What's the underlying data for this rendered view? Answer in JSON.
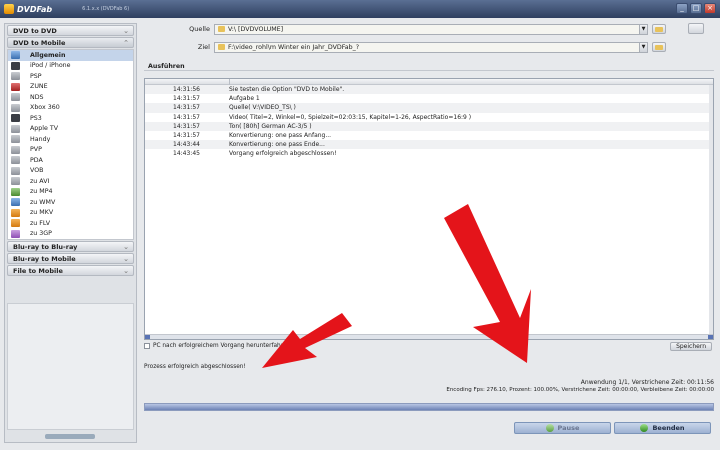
{
  "app": {
    "title": "DVDFab",
    "version": "6.1.x.x (DVDFab 6)"
  },
  "sidebar": {
    "categories_top": [
      "DVD to DVD",
      "DVD to Mobile"
    ],
    "items": [
      {
        "label": "Allgemein",
        "icon": "general-icon"
      },
      {
        "label": "iPod / iPhone",
        "icon": "ipod-icon"
      },
      {
        "label": "PSP",
        "icon": "psp-icon"
      },
      {
        "label": "ZUNE",
        "icon": "zune-icon"
      },
      {
        "label": "NDS",
        "icon": "nds-icon"
      },
      {
        "label": "Xbox 360",
        "icon": "xbox-icon"
      },
      {
        "label": "PS3",
        "icon": "ps3-icon"
      },
      {
        "label": "Apple TV",
        "icon": "appletv-icon"
      },
      {
        "label": "Handy",
        "icon": "phone-icon"
      },
      {
        "label": "PVP",
        "icon": "pvp-icon"
      },
      {
        "label": "PDA",
        "icon": "pda-icon"
      },
      {
        "label": "VOB",
        "icon": "vob-icon"
      },
      {
        "label": "zu AVI",
        "icon": "avi-icon"
      },
      {
        "label": "zu MP4",
        "icon": "mp4-icon"
      },
      {
        "label": "zu WMV",
        "icon": "wmv-icon"
      },
      {
        "label": "zu MKV",
        "icon": "mkv-icon"
      },
      {
        "label": "zu FLV",
        "icon": "flv-icon"
      },
      {
        "label": "zu 3GP",
        "icon": "3gp-icon"
      }
    ],
    "categories_bottom": [
      "Blu-ray to Blu-ray",
      "Blu-ray to Mobile",
      "File to Mobile"
    ]
  },
  "source": {
    "label": "Quelle",
    "value": "V:\\ [DVDVOLUME]"
  },
  "target": {
    "label": "Ziel",
    "value": "F:\\video_rohl\\m Winter ein Jahr_DVDFab_?"
  },
  "section": {
    "title": "Ausführen"
  },
  "log": [
    {
      "time": "14:31:56",
      "msg": "Sie testen die Option \"DVD to Mobile\"."
    },
    {
      "time": "14:31:57",
      "msg": "Aufgabe 1"
    },
    {
      "time": "14:31:57",
      "msg": "Quelle( V:\\VIDEO_TS\\ )"
    },
    {
      "time": "14:31:57",
      "msg": "Video( Titel=2, Winkel=0, Spielzeit=02:03:15, Kapitel=1-26, AspectRatio=16:9 )"
    },
    {
      "time": "14:31:57",
      "msg": "Ton( [80h] German AC-3/5 )"
    },
    {
      "time": "14:31:57",
      "msg": "Konvertierung: one pass Anfang..."
    },
    {
      "time": "14:43:44",
      "msg": "Konvertierung: one pass Ende..."
    },
    {
      "time": "14:43:45",
      "msg": "Vorgang erfolgreich abgeschlossen!"
    }
  ],
  "shutdown": {
    "label": "PC nach erfolgreichem Vorgang herunterfahren"
  },
  "save_label": "Speichern",
  "status_text": "Prozess erfolgreich abgeschlossen!",
  "stat_line1": "Anwendung 1/1,  Verstrichene Zeit: 00:11:56",
  "stat_line2": "Encoding Fps: 276.10,  Prozent: 100.00%,  Verstrichene Zeit: 00:00:00,  Verbleibene Zeit: 00:00:00",
  "progress": {
    "percent": 100
  },
  "buttons": {
    "pause": "Pause",
    "stop": "Beenden"
  },
  "colors": {
    "annotation_arrow": "#e4141a",
    "title_bar": "#3d5073"
  }
}
